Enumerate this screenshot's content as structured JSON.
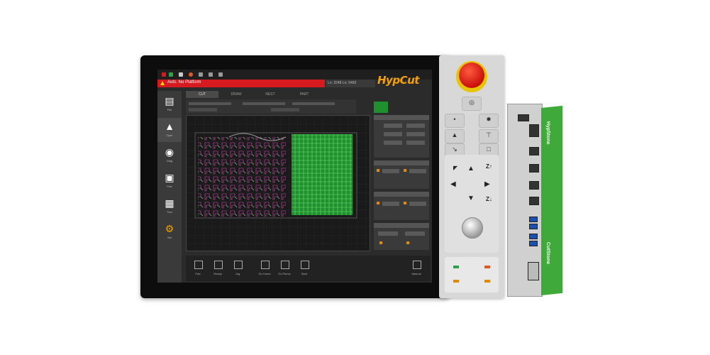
{
  "product": {
    "logo_text": "HypCut",
    "ipc_brand_text": "HypStone",
    "ipc_bottom_text": "CutStone"
  },
  "screen": {
    "tabs": [
      "CUT",
      "DRAW",
      "NEST",
      "PART"
    ],
    "alarm_text": "Auto. No Platform",
    "msg_text": "Ln: 3248 Ln: 5493",
    "sidebar": [
      {
        "icon": "document-icon",
        "label": "File"
      },
      {
        "icon": "operator-icon",
        "label": "Oper"
      },
      {
        "icon": "gauge-icon",
        "label": "Diag"
      },
      {
        "icon": "folder-icon",
        "label": "Part"
      },
      {
        "icon": "toolbox-icon",
        "label": "Tool"
      },
      {
        "icon": "gear-icon",
        "label": "Set"
      }
    ],
    "bottom_buttons": [
      "Part",
      "Ready",
      "Jog",
      "Go Home",
      "Go Pierce",
      "Start",
      "Manual"
    ]
  },
  "colors": {
    "brand_orange": "#f5a000",
    "alarm_red": "#d71920",
    "estop_red": "#d7231a",
    "estop_yellow": "#e8c500",
    "ipc_green": "#3faa3a",
    "nest_green": "#1f8f2f"
  }
}
